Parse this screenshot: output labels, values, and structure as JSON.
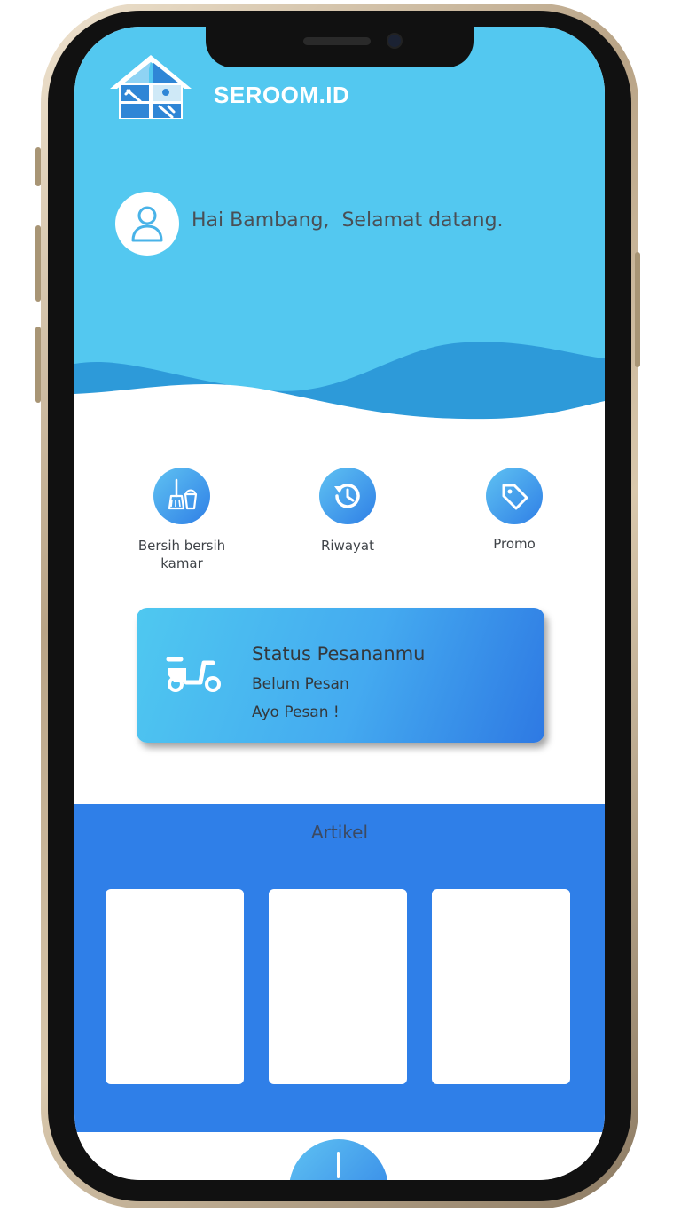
{
  "app": {
    "brand": "SEROOM.ID"
  },
  "header": {
    "greeting": "Hai Bambang,  Selamat datang."
  },
  "menu": [
    {
      "label": "Bersih bersih\nkamar",
      "icon": "broom-bucket-icon"
    },
    {
      "label": "Riwayat",
      "icon": "history-icon"
    },
    {
      "label": "Promo",
      "icon": "tag-icon"
    }
  ],
  "status": {
    "title": "Status Pesananmu",
    "line1": "Belum Pesan",
    "line2": "Ayo Pesan !",
    "icon": "scooter-icon"
  },
  "articles": {
    "title": "Artikel",
    "count_shown": 3
  },
  "colors": {
    "header_bg": "#53c8f0",
    "wave": "#2d9ad9",
    "article_bg": "#2f7fe8",
    "accent_gradient_start": "#5fc2f2",
    "accent_gradient_end": "#2f7fe6"
  }
}
